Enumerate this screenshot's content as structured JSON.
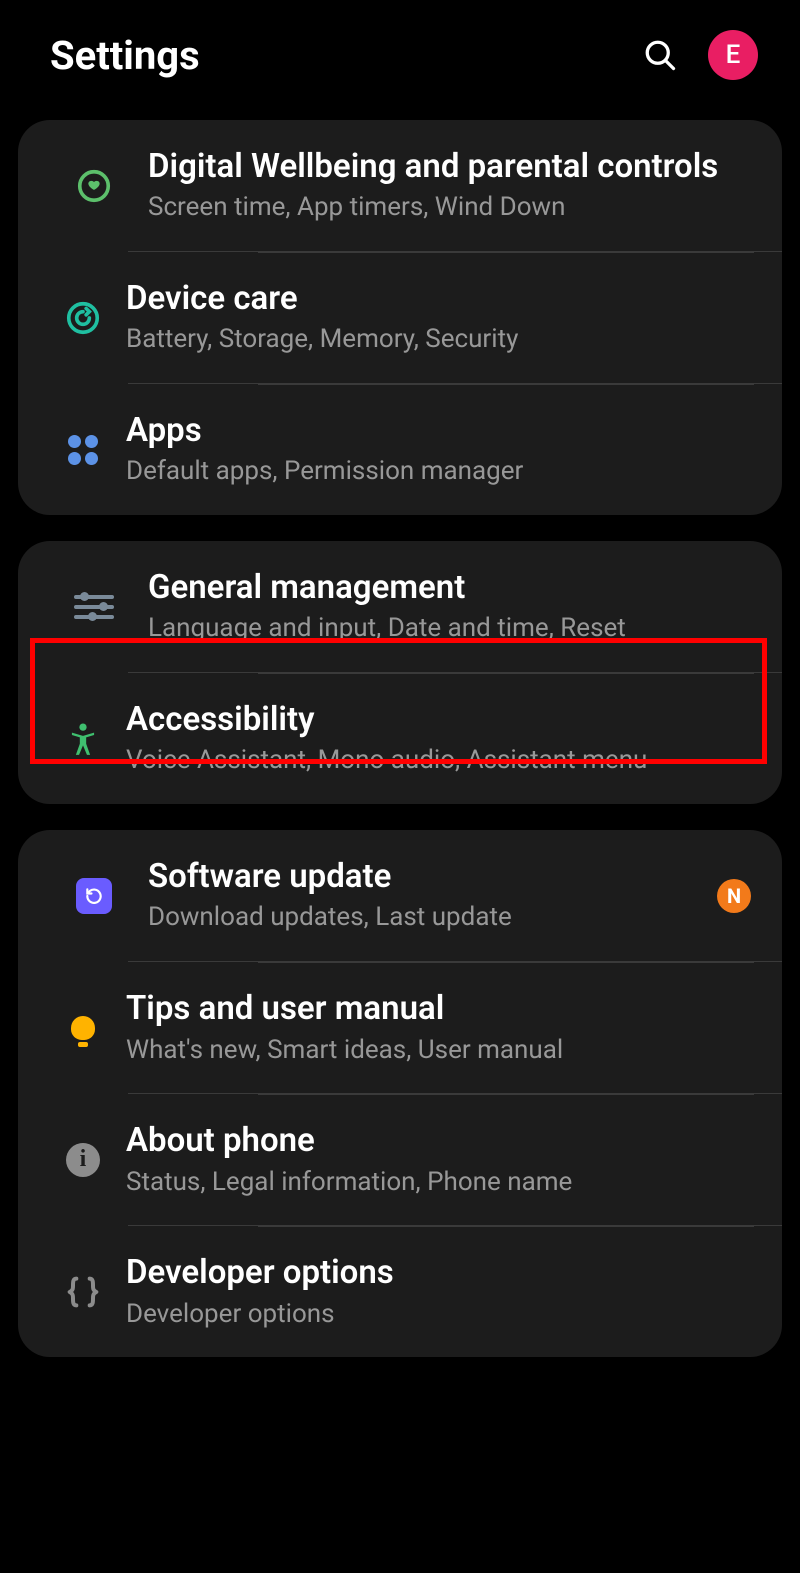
{
  "header": {
    "title": "Settings",
    "avatar_letter": "E"
  },
  "groups": [
    {
      "items": [
        {
          "id": "digital-wellbeing",
          "title": "Digital Wellbeing and parental controls",
          "subtitle": "Screen time, App timers, Wind Down",
          "icon": "wellbeing-icon",
          "icon_color": "#5cbf6b"
        },
        {
          "id": "device-care",
          "title": "Device care",
          "subtitle": "Battery, Storage, Memory, Security",
          "icon": "device-care-icon",
          "icon_color": "#1fbfa1"
        },
        {
          "id": "apps",
          "title": "Apps",
          "subtitle": "Default apps, Permission manager",
          "icon": "apps-icon",
          "icon_color": "#5c92e6"
        }
      ]
    },
    {
      "items": [
        {
          "id": "general-management",
          "title": "General management",
          "subtitle": "Language and input, Date and time, Reset",
          "icon": "sliders-icon",
          "icon_color": "#7a8a99",
          "highlighted": true
        },
        {
          "id": "accessibility",
          "title": "Accessibility",
          "subtitle": "Voice Assistant, Mono audio, Assistant menu",
          "icon": "accessibility-icon",
          "icon_color": "#3fbf6f"
        }
      ]
    },
    {
      "items": [
        {
          "id": "software-update",
          "title": "Software update",
          "subtitle": "Download updates, Last update",
          "icon": "software-update-icon",
          "icon_color": "#6a5cff",
          "badge": "N"
        },
        {
          "id": "tips",
          "title": "Tips and user manual",
          "subtitle": "What's new, Smart ideas, User manual",
          "icon": "lightbulb-icon",
          "icon_color": "#ffb300"
        },
        {
          "id": "about-phone",
          "title": "About phone",
          "subtitle": "Status, Legal information, Phone name",
          "icon": "info-icon",
          "icon_color": "#8c8c8c"
        },
        {
          "id": "developer-options",
          "title": "Developer options",
          "subtitle": "Developer options",
          "icon": "braces-icon",
          "icon_color": "#8c8c8c"
        }
      ]
    }
  ]
}
